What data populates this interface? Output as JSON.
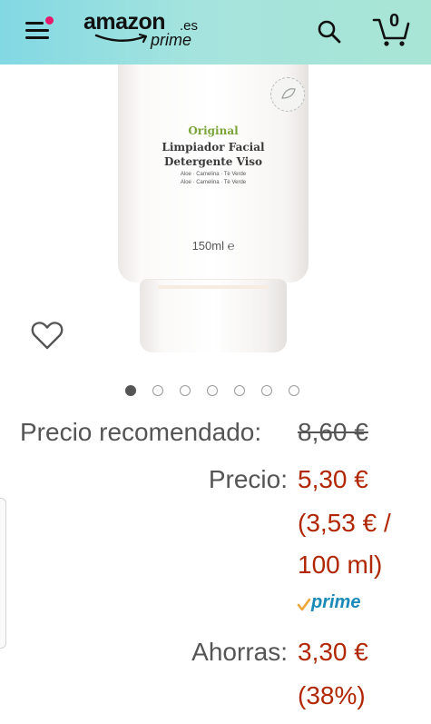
{
  "header": {
    "logo_brand": "amazon",
    "logo_tld": ".es",
    "logo_sub": "prime",
    "cart_count": "0",
    "colors": {
      "gradient_start": "#82d8e3",
      "gradient_end": "#a8e5d5",
      "notification_dot": "#e5196b"
    }
  },
  "product_image": {
    "label_original": "Original",
    "label_line1": "Limpiador Facial",
    "label_line2": "Detergente Viso",
    "ingredients_1": "Aloe · Camelina · Tè Verde",
    "ingredients_2": "Aloe · Camelina · Tè Verde",
    "volume": "150ml ℮"
  },
  "carousel": {
    "total": 7,
    "active_index": 0
  },
  "pricing": {
    "recommended_label": "Precio recomendado:",
    "recommended_value": "8,60 €",
    "price_label": "Precio:",
    "price_value": "5,30 €",
    "unit_price_line1": "(3,53 € /",
    "unit_price_line2": "100 ml)",
    "prime_badge": "prime",
    "savings_label": "Ahorras:",
    "savings_value": "3,30 €",
    "savings_percent": "(38%)",
    "colors": {
      "price": "#b12704",
      "label": "#555555",
      "prime": "#1c8ab8",
      "prime_check": "#f0a43a"
    }
  }
}
